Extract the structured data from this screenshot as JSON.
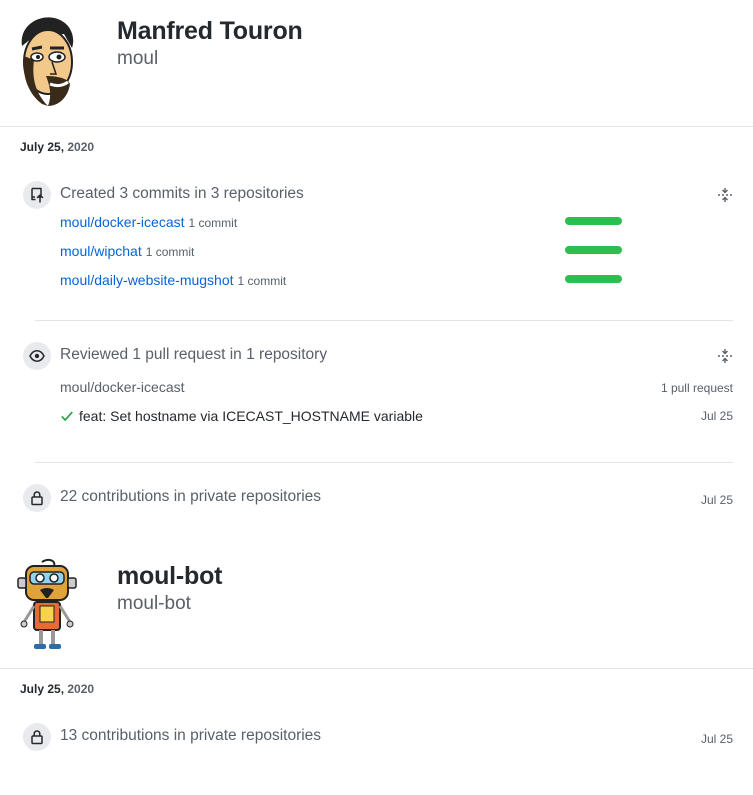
{
  "profiles": [
    {
      "name": "Manfred Touron",
      "login": "moul",
      "date_md": "July 25,",
      "date_year": "2020",
      "commits": {
        "summary": "Created 3 commits in 3 repositories",
        "repos": [
          {
            "name": "moul/docker-icecast",
            "count": "1 commit"
          },
          {
            "name": "moul/wipchat",
            "count": "1 commit"
          },
          {
            "name": "moul/daily-website-mugshot",
            "count": "1 commit"
          }
        ]
      },
      "reviews": {
        "summary": "Reviewed 1 pull request in 1 repository",
        "repo": "moul/docker-icecast",
        "repo_count": "1 pull request",
        "pr_title": "feat: Set hostname via ICECAST_HOSTNAME variable",
        "pr_date": "Jul 25"
      },
      "private": {
        "summary": "22 contributions in private repositories",
        "date": "Jul 25"
      }
    },
    {
      "name": "moul-bot",
      "login": "moul-bot",
      "date_md": "July 25,",
      "date_year": "2020",
      "private": {
        "summary": "13 contributions in private repositories",
        "date": "Jul 25"
      }
    }
  ],
  "colors": {
    "link": "#0366d6",
    "bar": "#2cbe4e",
    "check": "#28a745",
    "muted": "#586069"
  }
}
